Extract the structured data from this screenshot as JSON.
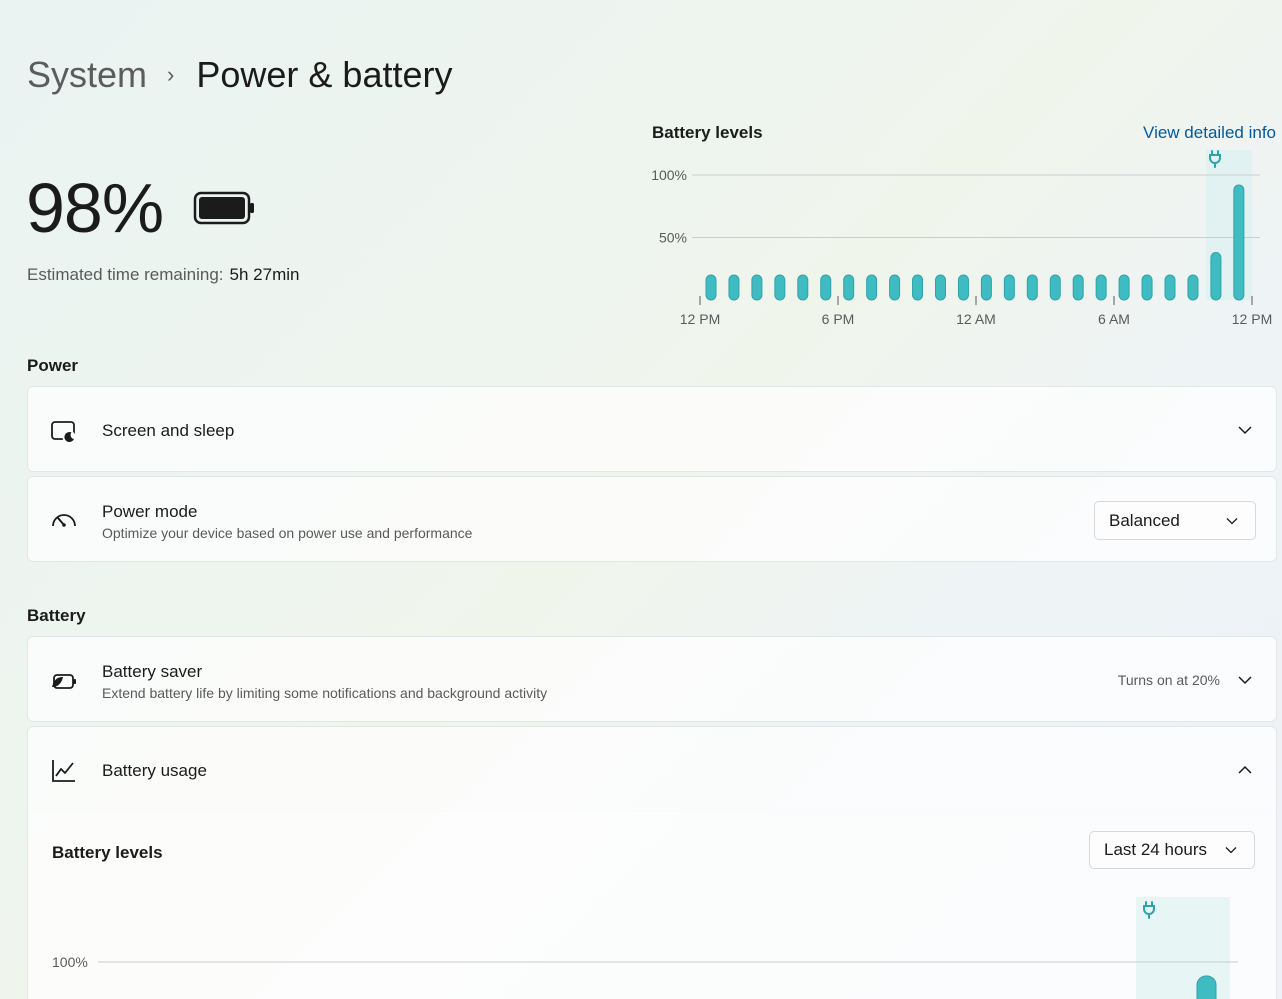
{
  "breadcrumb": {
    "parent": "System",
    "separator": "›",
    "current": "Power & battery"
  },
  "overview": {
    "percent": "98%",
    "estimate_label": "Estimated time remaining:",
    "estimate_value": "5h 27min"
  },
  "battery_chart": {
    "title": "Battery levels",
    "link": "View detailed info",
    "accent": "#3fbcc2"
  },
  "chart_data": [
    {
      "type": "bar",
      "title": "Battery levels",
      "yticks": [
        "100%",
        "50%"
      ],
      "xticks": [
        "12 PM",
        "6 PM",
        "12 AM",
        "6 AM",
        "12 PM"
      ],
      "ylim": [
        0,
        100
      ],
      "values": [
        20,
        20,
        20,
        20,
        20,
        20,
        20,
        20,
        20,
        20,
        20,
        20,
        20,
        20,
        20,
        20,
        20,
        20,
        20,
        20,
        20,
        20,
        38,
        92
      ],
      "charging_marker": "plug-icon"
    },
    {
      "type": "bar",
      "title": "Battery levels",
      "yticks": [
        "100%"
      ],
      "ylim": [
        0,
        100
      ],
      "charging_marker": "plug-icon"
    }
  ],
  "power": {
    "section_title": "Power",
    "screen_sleep": {
      "title": "Screen and sleep"
    },
    "power_mode": {
      "title": "Power mode",
      "subtitle": "Optimize your device based on power use and performance",
      "selected": "Balanced"
    }
  },
  "battery": {
    "section_title": "Battery",
    "saver": {
      "title": "Battery saver",
      "subtitle": "Extend battery life by limiting some notifications and background activity",
      "status": "Turns on at 20%"
    },
    "usage": {
      "title": "Battery usage"
    },
    "levels": {
      "title": "Battery levels",
      "range": "Last 24 hours"
    }
  }
}
